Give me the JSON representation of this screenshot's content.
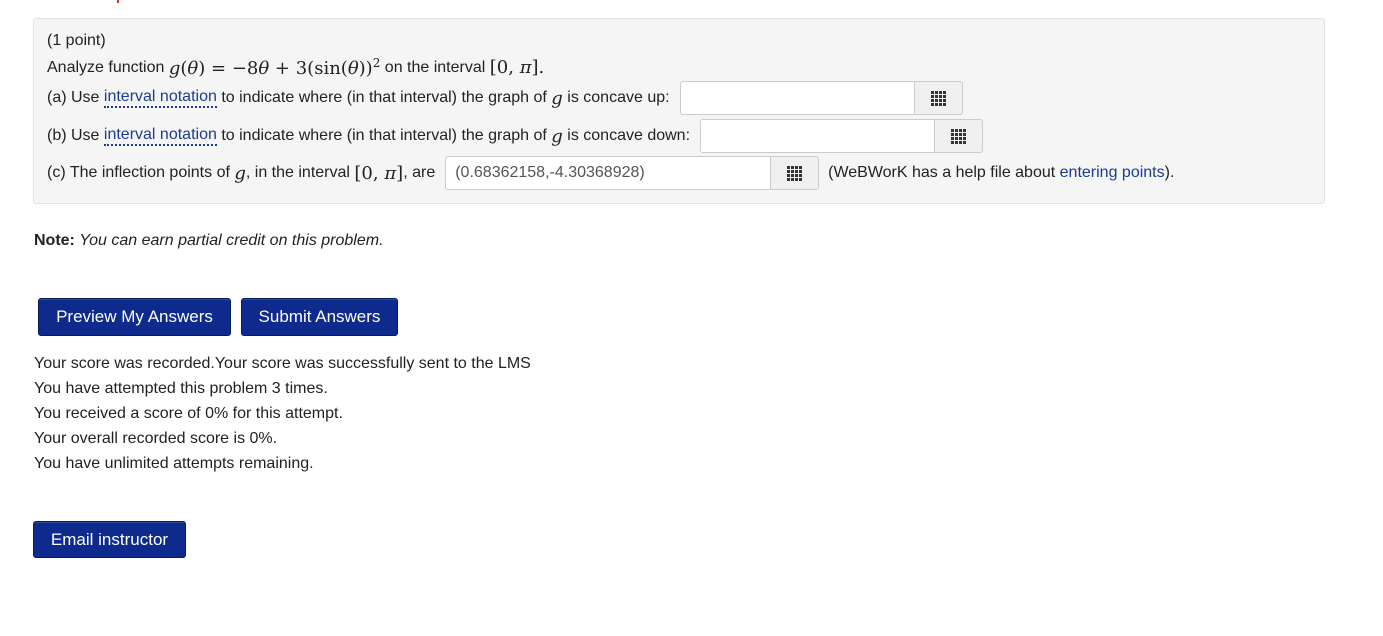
{
  "problem": {
    "points": "(1 point)",
    "intro_prefix": "Analyze function",
    "intro_suffix": "on the interval",
    "part_a": {
      "prefix": "(a) Use",
      "link": "interval notation",
      "middle": "to indicate where (in that interval) the graph of",
      "suffix": "is concave up:",
      "value": ""
    },
    "part_b": {
      "prefix": "(b) Use",
      "link": "interval notation",
      "middle": "to indicate where (in that interval) the graph of",
      "suffix": "is concave down:",
      "value": ""
    },
    "part_c": {
      "prefix": "(c) The inflection points of",
      "middle": ", in the interval",
      "suffix": ", are",
      "value": "(0.68362158,-4.30368928)",
      "help_prefix": "(WeBWorK has a help file about",
      "help_link": "entering points",
      "help_suffix": ")."
    }
  },
  "note": {
    "label": "Note:",
    "text": "You can earn partial credit on this problem."
  },
  "buttons": {
    "preview": "Preview My Answers",
    "submit": "Submit Answers",
    "email": "Email instructor"
  },
  "messages": [
    "Your score was recorded.Your score was successfully sent to the LMS",
    "You have attempted this problem 3 times.",
    "You received a score of 0% for this attempt.",
    "Your overall recorded score is 0%.",
    "You have unlimited attempts remaining."
  ],
  "colors": {
    "button_bg": "#0d2a8c",
    "link": "#1a3d8f",
    "panel_bg": "#f5f5f5"
  }
}
